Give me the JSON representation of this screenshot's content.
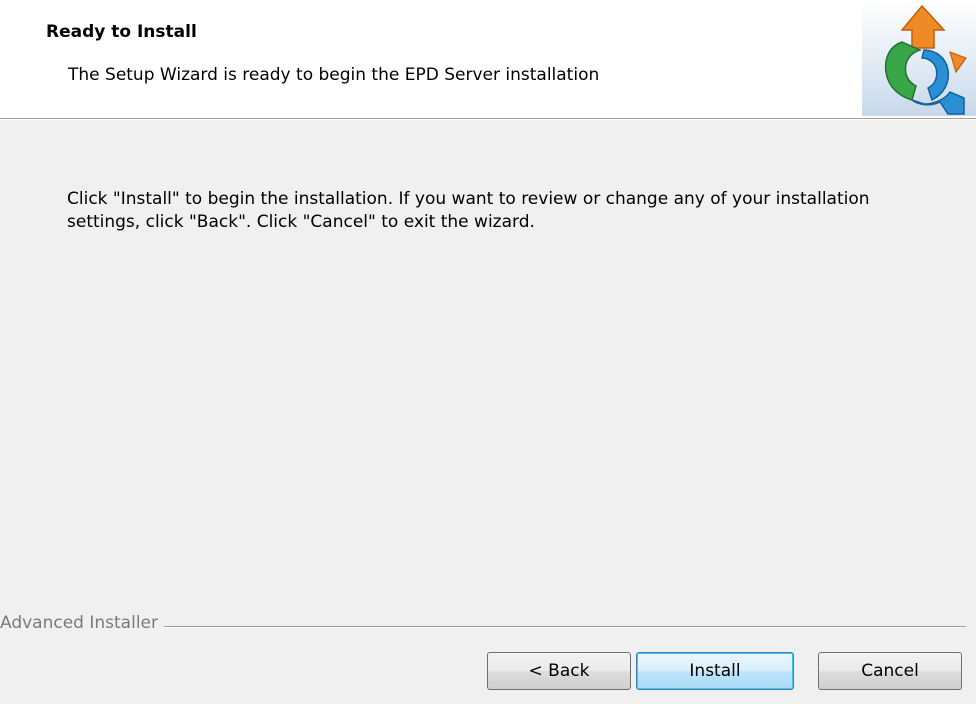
{
  "header": {
    "title": "Ready to Install",
    "subtitle": "The Setup Wizard is ready to begin the EPD Server installation",
    "logo_icon": "installer-puzzle-logo-icon"
  },
  "content": {
    "message": "Click \"Install\" to begin the installation.  If you want to review or change any of your installation settings, click \"Back\".  Click \"Cancel\" to exit the wizard."
  },
  "footer": {
    "brand_label": "Advanced Installer",
    "buttons": {
      "back": "< Back",
      "install": "Install",
      "cancel": "Cancel"
    }
  },
  "colors": {
    "header_background": "#ffffff",
    "body_background": "#f0f0f0",
    "default_button_border": "#3c7fb1",
    "brand_label_color": "#7a7a7a"
  }
}
